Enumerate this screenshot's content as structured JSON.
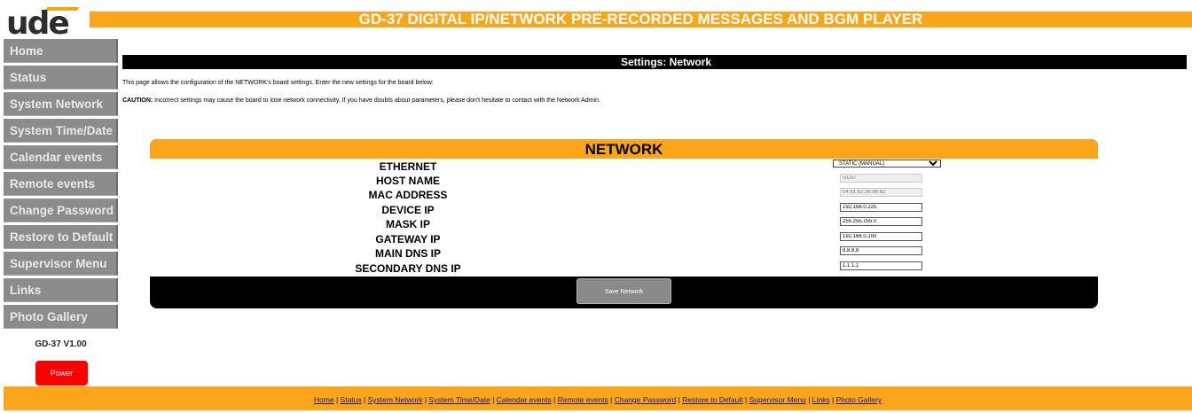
{
  "logo": {
    "text": "ude"
  },
  "header": {
    "title": "GD-37 DIGITAL IP/NETWORK PRE-RECORDED MESSAGES AND BGM PLAYER"
  },
  "sidebar": {
    "items": [
      {
        "label": "Home"
      },
      {
        "label": "Status"
      },
      {
        "label": "System Network"
      },
      {
        "label": "System Time/Date"
      },
      {
        "label": "Calendar events"
      },
      {
        "label": "Remote events"
      },
      {
        "label": "Change Password"
      },
      {
        "label": "Restore to Default"
      },
      {
        "label": "Supervisor Menu"
      },
      {
        "label": "Links"
      },
      {
        "label": "Photo Gallery"
      }
    ],
    "version": "GD-37 V1.00",
    "power_label": "Power"
  },
  "page": {
    "title": "Settings: Network",
    "description": "This page allows the configuration of the NETWORK's board settings. Enter the new settings for the board below:",
    "caution_label": "CAUTION:",
    "caution_text": " Incorrect settings may cause the board to lose network connectivity. If you have doubts about parameters, please don't hesitate to contact with the Network Admin."
  },
  "network": {
    "title": "NETWORK",
    "ethernet": {
      "label": "ETHERNET",
      "selected": "STATIC (MANUAL)"
    },
    "host_name": {
      "label": "HOST NAME",
      "value": "GD37"
    },
    "mac_address": {
      "label": "MAC ADDRESS",
      "value": "04:91:62:36:86:82"
    },
    "device_ip": {
      "label": "DEVICE IP",
      "value": "192.168.0.225"
    },
    "mask_ip": {
      "label": "MASK IP",
      "value": "255.255.255.0"
    },
    "gateway_ip": {
      "label": "GATEWAY IP",
      "value": "192.168.0.100"
    },
    "main_dns_ip": {
      "label": "MAIN DNS IP",
      "value": "8.8.8.8"
    },
    "secondary_dns_ip": {
      "label": "SECONDARY DNS IP",
      "value": "1.1.1.1"
    },
    "save_label": "Save Network"
  },
  "footer": {
    "links": [
      {
        "label": "Home"
      },
      {
        "label": "Status"
      },
      {
        "label": "System Network"
      },
      {
        "label": "System Time/Date"
      },
      {
        "label": "Calendar events"
      },
      {
        "label": "Remote events"
      },
      {
        "label": "Change Password"
      },
      {
        "label": "Restore to Default"
      },
      {
        "label": "Supervisor Menu"
      },
      {
        "label": "Links"
      },
      {
        "label": "Photo Gallery"
      }
    ],
    "separator": " | "
  },
  "colors": {
    "accent": "#faa51a",
    "nav": "#8c8c8c",
    "power": "#ff0000",
    "bar": "#000000"
  }
}
